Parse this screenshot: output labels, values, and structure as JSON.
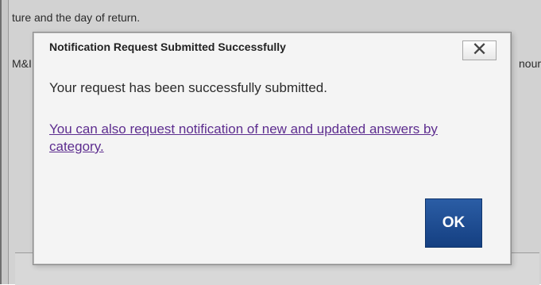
{
  "background": {
    "line_1": "ture and the day of return.",
    "line_2": "M&I",
    "line_3": "nour"
  },
  "dialog": {
    "title": "Notification Request Submitted Successfully",
    "message": "Your request has been successfully submitted.",
    "link_text": "You can also request notification of new and updated answers by category.",
    "ok_label": "OK",
    "close_icon": "close-icon",
    "close_glyph": "✕",
    "colors": {
      "dialog_background": "#f4f4f4",
      "ok_button_blue": "#1f4f95",
      "link_purple": "#5d2d8f"
    }
  }
}
